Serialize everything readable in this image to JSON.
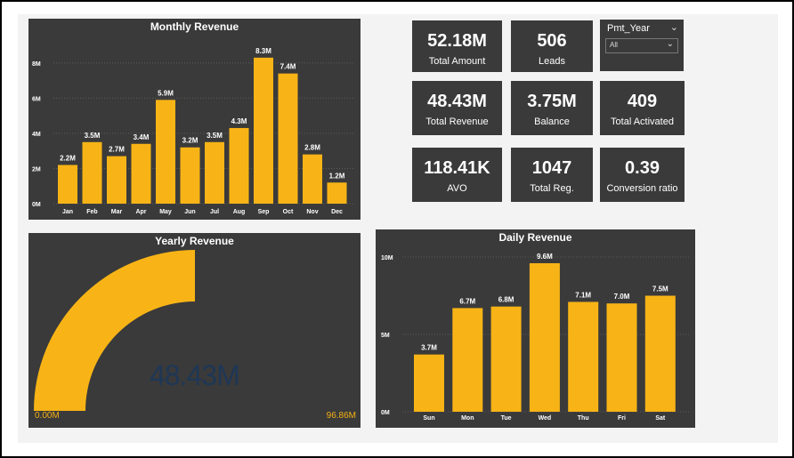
{
  "colors": {
    "accent": "#F8B416",
    "panel_bg": "#3A3A3A",
    "gauge_value": "#1E3756"
  },
  "kpis": {
    "total_amount": {
      "value": "52.18M",
      "label": "Total Amount"
    },
    "leads": {
      "value": "506",
      "label": "Leads"
    },
    "total_revenue": {
      "value": "48.43M",
      "label": "Total Revenue"
    },
    "balance": {
      "value": "3.75M",
      "label": "Balance"
    },
    "total_activated": {
      "value": "409",
      "label": "Total Activated"
    },
    "avo": {
      "value": "118.41K",
      "label": "AVO"
    },
    "total_reg": {
      "value": "1047",
      "label": "Total Reg."
    },
    "conversion_ratio": {
      "value": "0.39",
      "label": "Conversion ratio"
    }
  },
  "slicer": {
    "title": "Pmt_Year",
    "selected": "All",
    "icon": "chevron-down-icon"
  },
  "chart_data": [
    {
      "type": "bar",
      "title": "Monthly Revenue",
      "categories": [
        "Jan",
        "Feb",
        "Mar",
        "Apr",
        "May",
        "Jun",
        "Jul",
        "Aug",
        "Sep",
        "Oct",
        "Nov",
        "Dec"
      ],
      "values": [
        2.2,
        3.5,
        2.7,
        3.4,
        5.9,
        3.2,
        3.5,
        4.3,
        8.3,
        7.4,
        2.8,
        1.2
      ],
      "data_labels": [
        "2.2M",
        "3.5M",
        "2.7M",
        "3.4M",
        "5.9M",
        "3.2M",
        "3.5M",
        "4.3M",
        "8.3M",
        "7.4M",
        "2.8M",
        "1.2M"
      ],
      "yticks": [
        0,
        2,
        4,
        6,
        8
      ],
      "ytick_labels": [
        "0M",
        "2M",
        "4M",
        "6M",
        "8M"
      ],
      "ylim": [
        0,
        9
      ],
      "unit": "M",
      "grid": true
    },
    {
      "type": "gauge",
      "title": "Yearly Revenue",
      "value": 48.43,
      "value_label": "48.43M",
      "min": 0,
      "max": 96.86,
      "min_label": "0.00M",
      "max_label": "96.86M",
      "unit": "M"
    },
    {
      "type": "bar",
      "title": "Daily Revenue",
      "categories": [
        "Sun",
        "Mon",
        "Tue",
        "Wed",
        "Thu",
        "Fri",
        "Sat"
      ],
      "values": [
        3.7,
        6.7,
        6.8,
        9.6,
        7.1,
        7.0,
        7.5
      ],
      "data_labels": [
        "3.7M",
        "6.7M",
        "6.8M",
        "9.6M",
        "7.1M",
        "7.0M",
        "7.5M"
      ],
      "yticks": [
        0,
        5,
        10
      ],
      "ytick_labels": [
        "0M",
        "5M",
        "10M"
      ],
      "ylim": [
        0,
        10
      ],
      "unit": "M",
      "grid": true
    }
  ]
}
